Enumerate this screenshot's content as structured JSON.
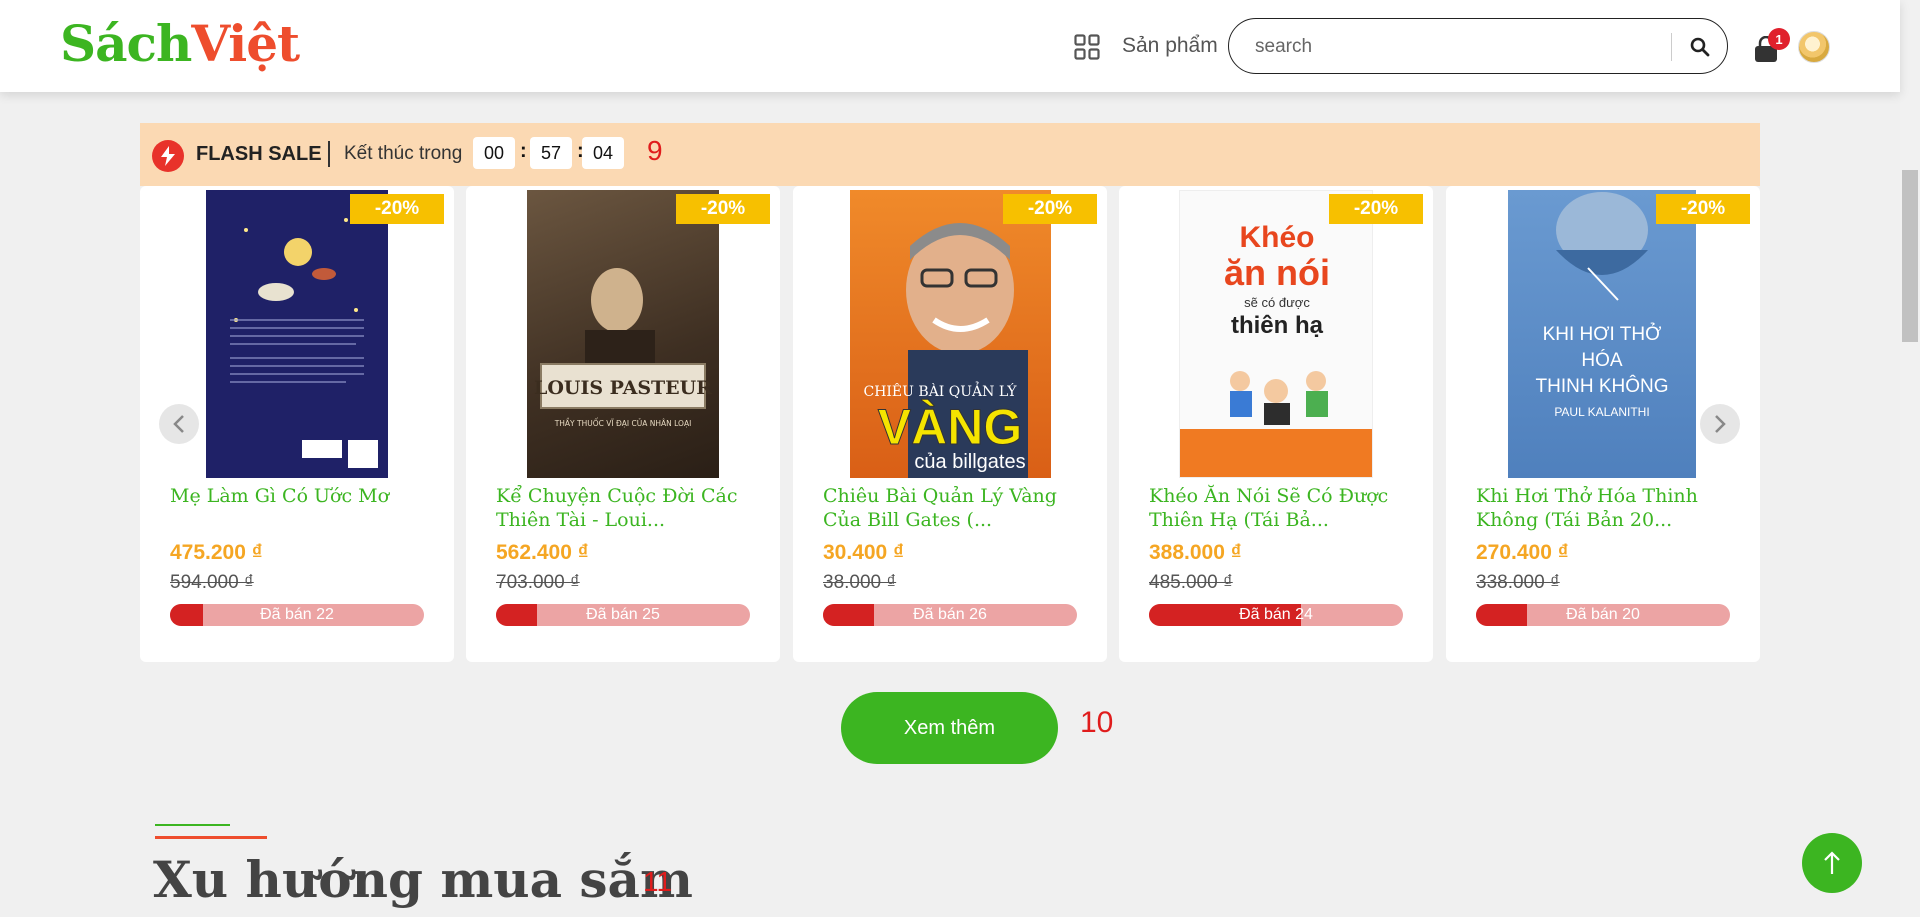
{
  "header": {
    "logo_part1": "Sách",
    "logo_part2": "Việt",
    "products_label": "Sản phẩm",
    "search_placeholder": "search",
    "cart_count": "1"
  },
  "flash_sale": {
    "title": "FLASH SALE",
    "ends_in_label": "Kết thúc trong",
    "hours": "00",
    "minutes": "57",
    "seconds": "04",
    "marker": "9"
  },
  "products": [
    {
      "title": "Mẹ Làm Gì Có Ước Mơ",
      "discount": "-20%",
      "price": "475.200 ₫",
      "old_price": "594.000 ₫",
      "sold_label": "Đã bán 22",
      "sold_fraction": 0.13,
      "cover_color": "#1f2167"
    },
    {
      "title": "Kể Chuyện Cuộc Đời Các Thiên Tài - Loui...",
      "discount": "-20%",
      "price": "562.400 ₫",
      "old_price": "703.000 ₫",
      "sold_label": "Đã bán 25",
      "sold_fraction": 0.16,
      "cover_color": "#4a3a2a",
      "cover_text": "LOUIS PASTEUR",
      "cover_sub": "THẦY THUỐC VĨ ĐẠI CỦA NHÂN LOẠI"
    },
    {
      "title": "Chiêu Bài Quản Lý Vàng Của Bill Gates (...",
      "discount": "-20%",
      "price": "30.400 ₫",
      "old_price": "38.000 ₫",
      "sold_label": "Đã bán 26",
      "sold_fraction": 0.2,
      "cover_color": "#e8741e",
      "cover_text": "CHIÊU BÀI QUẢN LÝ",
      "cover_big": "VÀNG",
      "cover_sub": "của billgates"
    },
    {
      "title": "Khéo Ăn Nói Sẽ Có Được Thiên Hạ (Tái Bả...",
      "discount": "-20%",
      "price": "388.000 ₫",
      "old_price": "485.000 ₫",
      "sold_label": "Đã bán 24",
      "sold_fraction": 0.6,
      "cover_color": "#f7f7f7",
      "cover_text": "Khéo ăn nói",
      "cover_sub": "sẽ có được thiên hạ"
    },
    {
      "title": "Khi Hơi Thở Hóa Thinh Không (Tái Bản 20...",
      "discount": "-20%",
      "price": "270.400 ₫",
      "old_price": "338.000 ₫",
      "sold_label": "Đã bán 20",
      "sold_fraction": 0.2,
      "cover_color": "#5b8fc9",
      "cover_text": "KHI HƠI THỞ HÓA THINH KHÔNG",
      "cover_sub": "PAUL KALANITHI"
    }
  ],
  "more_button": "Xem thêm",
  "marker10": "10",
  "trend_heading": "Xu hướng mua sắm",
  "marker11": "11",
  "colors": {
    "brand_green": "#3cb521",
    "brand_orange": "#ee4d2d",
    "price": "#f5a623",
    "discount": "#f7c000",
    "sold": "#d42222"
  }
}
